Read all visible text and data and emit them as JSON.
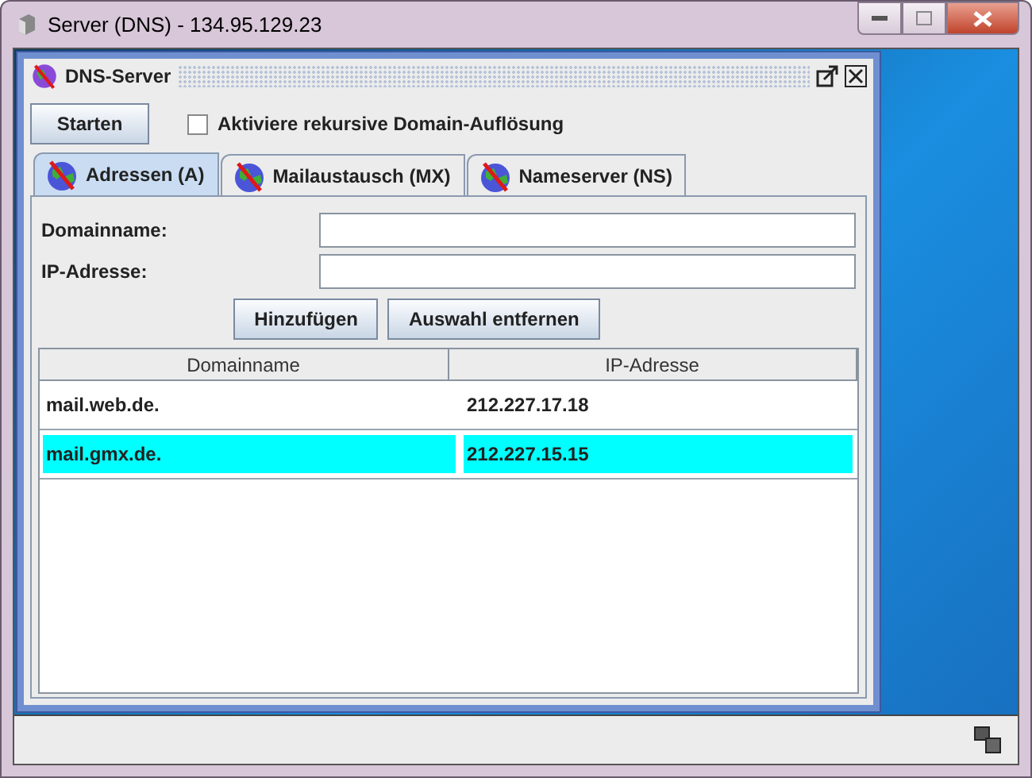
{
  "window": {
    "title": "Server (DNS) - 134.95.129.23"
  },
  "internal_frame": {
    "title": "DNS-Server"
  },
  "start_button": "Starten",
  "recursive_checkbox": {
    "label": "Aktiviere rekursive Domain-Auflösung",
    "checked": false
  },
  "tabs": [
    {
      "label": "Adressen (A)",
      "selected": true
    },
    {
      "label": "Mailaustausch (MX)",
      "selected": false
    },
    {
      "label": "Nameserver (NS)",
      "selected": false
    }
  ],
  "fields": [
    {
      "label": "Domainname:"
    },
    {
      "label": "IP-Adresse:"
    }
  ],
  "buttons": [
    "Hinzufügen",
    "Auswahl entfernen"
  ],
  "table": {
    "columns": [
      "Domainname",
      "IP-Adresse"
    ],
    "rows": [
      {
        "cells": [
          "mail.web.de.",
          "212.227.17.18"
        ],
        "selected": false
      },
      {
        "cells": [
          "mail.gmx.de.",
          "212.227.15.15"
        ],
        "selected": true
      }
    ]
  }
}
